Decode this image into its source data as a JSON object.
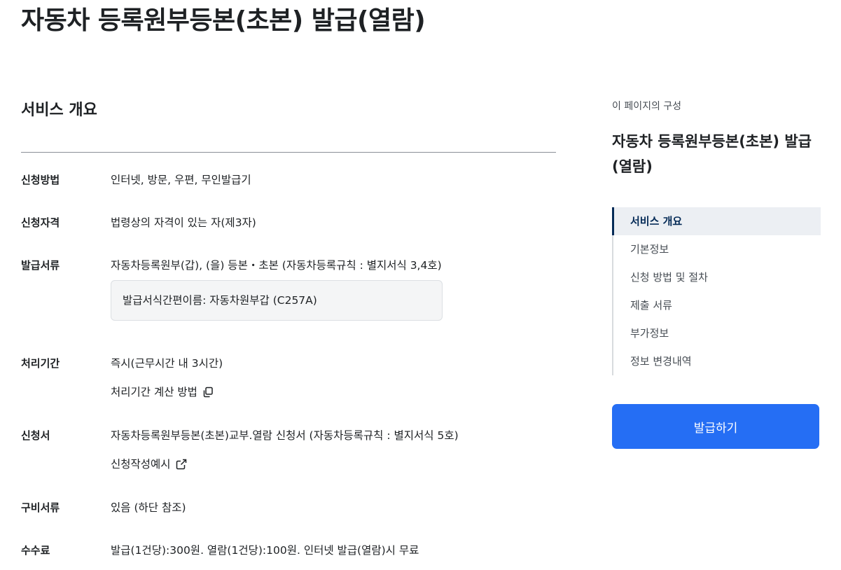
{
  "page": {
    "title": "자동차 등록원부등본(초본) 발급(열람)"
  },
  "main": {
    "section_title": "서비스 개요",
    "rows": [
      {
        "label": "신청방법",
        "value": "인터넷, 방문, 우편, 무인발급기"
      },
      {
        "label": "신청자격",
        "value": "법령상의 자격이 있는 자(제3자)"
      },
      {
        "label": "발급서류",
        "value": "자동차등록원부(갑), (을) 등본・초본 (자동차등록규칙 : 별지서식 3,4호)",
        "note": "발급서식간편이름: 자동차원부갑 (C257A)"
      },
      {
        "label": "처리기간",
        "value": "즉시(근무시간 내 3시간)",
        "link": "처리기간 계산 방법",
        "link_icon": "copy-icon"
      },
      {
        "label": "신청서",
        "value": "자동차등록원부등본(초본)교부.열람 신청서 (자동차등록규칙 : 별지서식 5호)",
        "link": "신청작성예시",
        "link_icon": "external-link-icon"
      },
      {
        "label": "구비서류",
        "value": "있음 (하단 참조)"
      },
      {
        "label": "수수료",
        "value": "발급(1건당):300원. 열람(1건당):100원. 인터넷 발급(열람)시 무료"
      }
    ]
  },
  "aside": {
    "caption": "이 페이지의 구성",
    "title": "자동차 등록원부등본(초본) 발급(열람)",
    "toc": [
      {
        "label": "서비스 개요",
        "active": true
      },
      {
        "label": "기본정보",
        "active": false
      },
      {
        "label": "신청 방법 및 절차",
        "active": false
      },
      {
        "label": "제출 서류",
        "active": false
      },
      {
        "label": "부가정보",
        "active": false
      },
      {
        "label": "정보 변경내역",
        "active": false
      }
    ],
    "button_label": "발급하기"
  },
  "colors": {
    "primary_button": "#256ef4",
    "toc_active_bg": "#eceff3",
    "toc_active_text": "#052b57",
    "text": "#1e2124"
  }
}
